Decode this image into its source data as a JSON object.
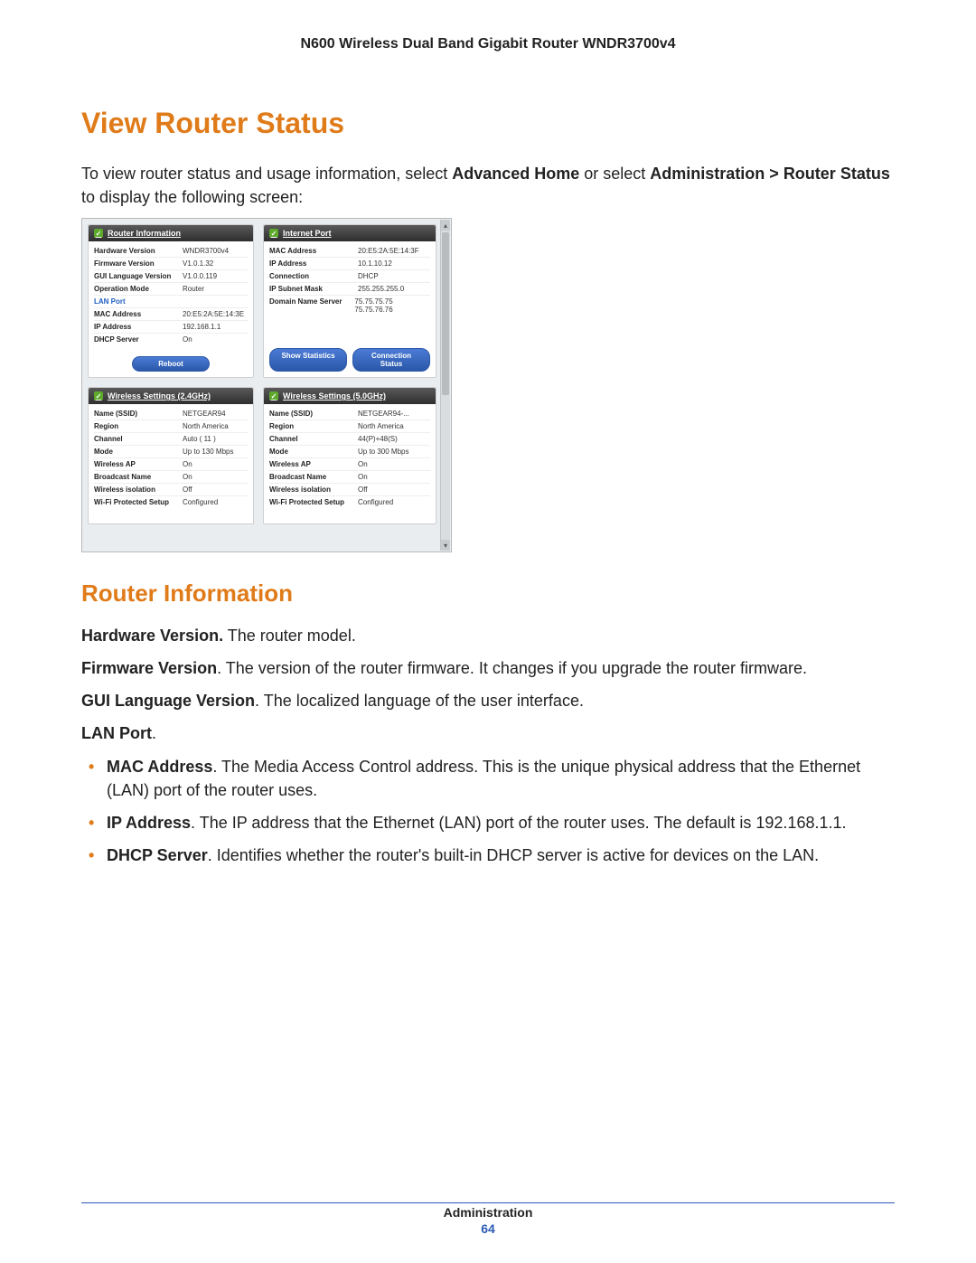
{
  "header": "N600 Wireless Dual Band Gigabit Router WNDR3700v4",
  "h1": "View Router Status",
  "intro": {
    "pre": "To view router status and usage information, select ",
    "strong1": "Advanced Home",
    "mid": " or select ",
    "strong2": "Administration > Router Status",
    "post": " to display the following screen:"
  },
  "panels": {
    "router_info": {
      "title": "Router Information",
      "rows": [
        {
          "k": "Hardware Version",
          "v": "WNDR3700v4"
        },
        {
          "k": "Firmware Version",
          "v": "V1.0.1.32"
        },
        {
          "k": "GUI Language Version",
          "v": "V1.0.0.119"
        },
        {
          "k": "Operation Mode",
          "v": "Router"
        }
      ],
      "lan_label": "LAN Port",
      "lan_rows": [
        {
          "k": "MAC Address",
          "v": "20:E5:2A:5E:14:3E"
        },
        {
          "k": "IP Address",
          "v": "192.168.1.1"
        },
        {
          "k": "DHCP Server",
          "v": "On"
        }
      ],
      "btn_reboot": "Reboot"
    },
    "internet": {
      "title": "Internet Port",
      "rows": [
        {
          "k": "MAC Address",
          "v": "20:E5:2A:5E:14:3F"
        },
        {
          "k": "IP Address",
          "v": "10.1.10.12"
        },
        {
          "k": "Connection",
          "v": "DHCP"
        },
        {
          "k": "IP Subnet Mask",
          "v": "255.255.255.0"
        },
        {
          "k": "Domain Name Server",
          "v": "75.75.75.75 75.75.76.76"
        }
      ],
      "btn_stats": "Show Statistics",
      "btn_conn": "Connection Status"
    },
    "w24": {
      "title": "Wireless Settings (2.4GHz)",
      "rows": [
        {
          "k": "Name (SSID)",
          "v": "NETGEAR94"
        },
        {
          "k": "Region",
          "v": "North America"
        },
        {
          "k": "Channel",
          "v": "Auto ( 11 )"
        },
        {
          "k": "Mode",
          "v": "Up to 130 Mbps"
        },
        {
          "k": "Wireless AP",
          "v": "On"
        },
        {
          "k": "Broadcast Name",
          "v": "On"
        },
        {
          "k": "Wireless isolation",
          "v": "Off"
        },
        {
          "k": "Wi-Fi Protected Setup",
          "v": "Configured"
        }
      ]
    },
    "w50": {
      "title": "Wireless Settings (5.0GHz)",
      "rows": [
        {
          "k": "Name (SSID)",
          "v": "NETGEAR94-..."
        },
        {
          "k": "Region",
          "v": "North America"
        },
        {
          "k": "Channel",
          "v": "44(P)+48(S)"
        },
        {
          "k": "Mode",
          "v": "Up to 300 Mbps"
        },
        {
          "k": "Wireless AP",
          "v": "On"
        },
        {
          "k": "Broadcast Name",
          "v": "On"
        },
        {
          "k": "Wireless isolation",
          "v": "Off"
        },
        {
          "k": "Wi-Fi Protected Setup",
          "v": "Configured"
        }
      ]
    }
  },
  "h2": "Router Information",
  "defs": {
    "hwv": {
      "t": "Hardware Version.",
      "d": " The router model."
    },
    "fwv": {
      "t": "Firmware Version",
      "d": ". The version of the router firmware. It changes if you upgrade the router firmware."
    },
    "gui": {
      "t": "GUI Language Version",
      "d": ". The localized language of the user interface."
    },
    "lan": {
      "t": "LAN Port",
      "d": "."
    },
    "bullets": {
      "mac": {
        "t": "MAC Address",
        "d": ". The Media Access Control address. This is the unique physical address that the Ethernet (LAN) port of the router uses."
      },
      "ip": {
        "t": "IP Address",
        "d": ". The IP address that the Ethernet (LAN) port of the router uses. The default is 192.168.1.1."
      },
      "dhcp": {
        "t": "DHCP Server",
        "d": ". Identifies whether the router's built-in DHCP server is active for devices on the LAN."
      }
    }
  },
  "footer": {
    "section": "Administration",
    "page": "64"
  }
}
